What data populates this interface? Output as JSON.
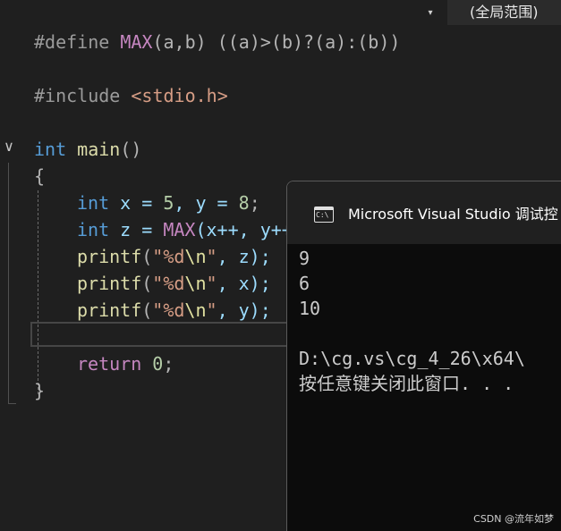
{
  "scope_bar": {
    "dropdown_glyph": "▾",
    "scope_label": "(全局范围)"
  },
  "editor": {
    "fold_glyph": "∨",
    "lines": [
      [
        "#define ",
        "MAX",
        "(a,b) ((a)>(b)?(a):(b))"
      ],
      [
        "#include ",
        "<stdio.h>"
      ],
      [
        "int",
        " ",
        "main",
        "()"
      ],
      [
        "{"
      ],
      [
        "int",
        " x = ",
        "5",
        ", y = ",
        "8",
        ";"
      ],
      [
        "int",
        " z = ",
        "MAX",
        "(x++, y++"
      ],
      [
        "printf",
        "(",
        "\"%d",
        "\\n",
        "\"",
        ", z);"
      ],
      [
        "printf",
        "(",
        "\"%d",
        "\\n",
        "\"",
        ", x);"
      ],
      [
        "printf",
        "(",
        "\"%d",
        "\\n",
        "\"",
        ", y);"
      ],
      [
        "return",
        " ",
        "0",
        ";"
      ],
      [
        "}"
      ]
    ]
  },
  "console": {
    "icon_text": "C:\\",
    "title": "Microsoft Visual Studio 调试控",
    "output": [
      "9",
      "6",
      "10",
      "",
      "D:\\cg.vs\\cg_4_26\\x64\\",
      "按任意键关闭此窗口. . ."
    ]
  },
  "watermark": "CSDN @流年如梦",
  "colors": {
    "background": "#1f1f1f",
    "keyword": "#569cd6",
    "function": "#dcdcaa",
    "macro": "#c586c0",
    "string": "#d69d85",
    "number": "#b5cea8",
    "console_background": "#0c0c0c"
  }
}
